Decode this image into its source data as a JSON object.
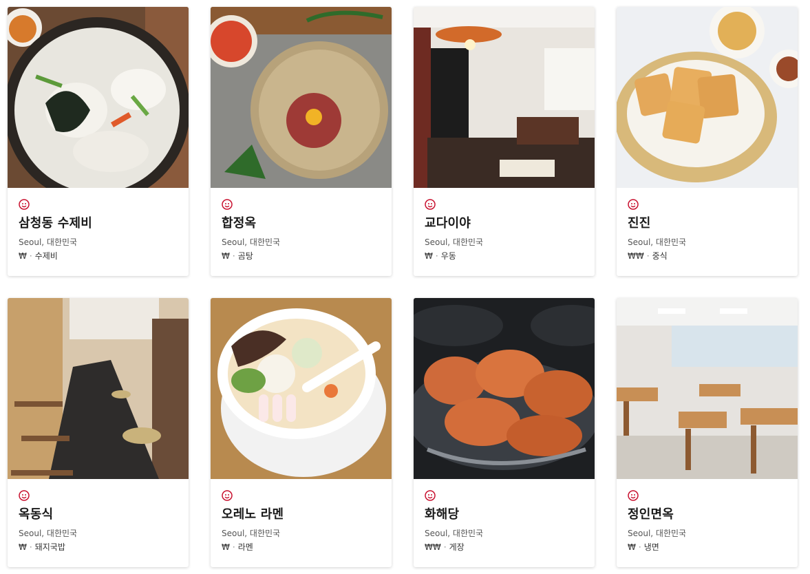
{
  "brand": {
    "accent": "#c8102e"
  },
  "cards": [
    {
      "name": "삼청동 수제비",
      "location": "Seoul, 대한민국",
      "price": "₩",
      "separator": "·",
      "cuisine": "수제비",
      "image": "sujebi-soup-photo",
      "award_icon": "bib-gourmand-icon"
    },
    {
      "name": "합정옥",
      "location": "Seoul, 대한민국",
      "price": "₩",
      "separator": "·",
      "cuisine": "곰탕",
      "image": "yukhoe-plate-photo",
      "award_icon": "bib-gourmand-icon"
    },
    {
      "name": "교다이야",
      "location": "Seoul, 대한민국",
      "price": "₩",
      "separator": "·",
      "cuisine": "우동",
      "image": "udon-restaurant-interior-photo",
      "award_icon": "bib-gourmand-icon"
    },
    {
      "name": "진진",
      "location": "Seoul, 대한민국",
      "price": "₩₩",
      "separator": "·",
      "cuisine": "중식",
      "image": "fried-toast-basket-photo",
      "award_icon": "bib-gourmand-icon"
    },
    {
      "name": "옥동식",
      "location": "Seoul, 대한민국",
      "price": "₩",
      "separator": "·",
      "cuisine": "돼지국밥",
      "image": "counter-bar-interior-photo",
      "award_icon": "bib-gourmand-icon"
    },
    {
      "name": "오레노 라멘",
      "location": "Seoul, 대한민국",
      "price": "₩",
      "separator": "·",
      "cuisine": "라멘",
      "image": "ramen-bowl-photo",
      "award_icon": "bib-gourmand-icon"
    },
    {
      "name": "화해당",
      "location": "Seoul, 대한민국",
      "price": "₩₩",
      "separator": "·",
      "cuisine": "게장",
      "image": "marinated-crab-photo",
      "award_icon": "bib-gourmand-icon"
    },
    {
      "name": "정인면옥",
      "location": "Seoul, 대한민국",
      "price": "₩",
      "separator": "·",
      "cuisine": "냉면",
      "image": "dining-hall-interior-photo",
      "award_icon": "bib-gourmand-icon"
    }
  ]
}
